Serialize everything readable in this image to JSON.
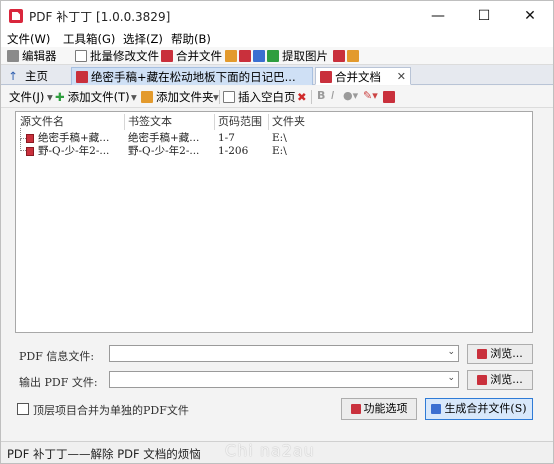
{
  "window": {
    "title": "PDF 补丁丁 [1.0.0.3829]",
    "controls": {
      "minimize": "—",
      "maximize": "☐",
      "close": "✕"
    }
  },
  "menu": [
    "文件(W)",
    "工具箱(G)",
    "选择(Z)",
    "帮助(B)"
  ],
  "quick_toolbar": {
    "editor": "编辑器",
    "batch_edit": "批量修改文件",
    "merge": "合并文件",
    "extract_images": "提取图片"
  },
  "tabs": {
    "home": "主页",
    "document": "绝密手稿+藏在松动地板下面的日记巴...",
    "merge": "合并文档",
    "close": "✕"
  },
  "panel_toolbar": {
    "file_menu": "文件(J)",
    "add_file": "添加文件(T)",
    "add_folder": "添加文件夹",
    "insert_blank": "插入空白页",
    "bold": "B",
    "italic": "I"
  },
  "list": {
    "columns": [
      "源文件名",
      "书签文本",
      "页码范围",
      "文件夹"
    ],
    "rows": [
      {
        "file": "绝密手稿+藏...",
        "bookmark": "绝密手稿+藏...",
        "pages": "1-7",
        "folder": "E:\\"
      },
      {
        "file": "野-Q-少-年2-...",
        "bookmark": "野-Q-少-年2-...",
        "pages": "1-206",
        "folder": "E:\\"
      }
    ]
  },
  "form": {
    "info_label": "PDF 信息文件:",
    "info_value": "",
    "output_label": "输出 PDF 文件:",
    "output_value": "",
    "browse": "浏览...",
    "checkbox_label": "顶层项目合并为单独的PDF文件",
    "options_button": "功能选项",
    "generate_button": "生成合并文件(S)"
  },
  "status": "PDF 补丁丁——解除 PDF 文档的烦恼",
  "watermark": "Chi na2au",
  "colors": {
    "accent": "#2f7bd6",
    "pdf_red": "#c9303c",
    "tab_active": "#cfe0f5"
  }
}
